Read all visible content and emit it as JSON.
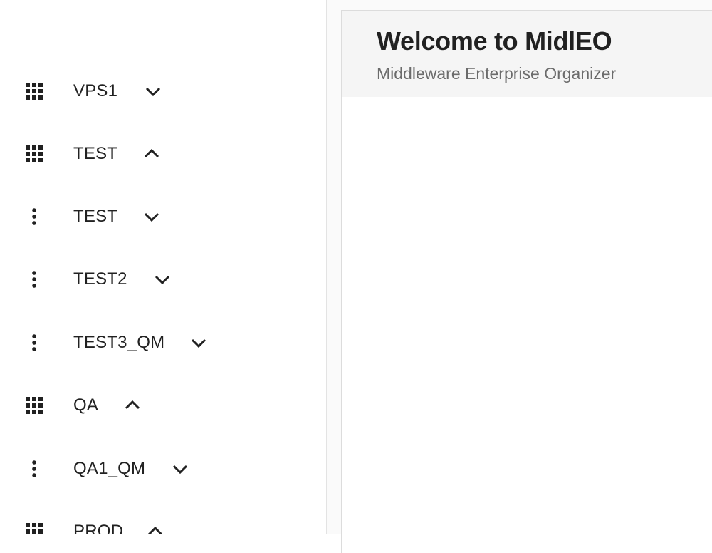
{
  "sidebar": {
    "items": [
      {
        "label": "VPS1",
        "icon": "apps-grid-icon",
        "chevron": "chevron-down-icon"
      },
      {
        "label": "TEST",
        "icon": "apps-grid-icon",
        "chevron": "chevron-up-icon"
      },
      {
        "label": "TEST",
        "icon": "more-vertical-icon",
        "chevron": "chevron-down-icon"
      },
      {
        "label": "TEST2",
        "icon": "more-vertical-icon",
        "chevron": "chevron-down-icon"
      },
      {
        "label": "TEST3_QM",
        "icon": "more-vertical-icon",
        "chevron": "chevron-down-icon"
      },
      {
        "label": "QA",
        "icon": "apps-grid-icon",
        "chevron": "chevron-up-icon"
      },
      {
        "label": "QA1_QM",
        "icon": "more-vertical-icon",
        "chevron": "chevron-down-icon"
      },
      {
        "label": "PROD",
        "icon": "apps-grid-icon",
        "chevron": "chevron-up-icon"
      }
    ]
  },
  "main": {
    "title": "Welcome to MidlEO",
    "subtitle": "Middleware Enterprise Organizer"
  },
  "colors": {
    "text": "#212121",
    "subtitle": "#6b6b6b",
    "header_bg": "#f5f5f5",
    "page_bg": "#fafafa"
  }
}
